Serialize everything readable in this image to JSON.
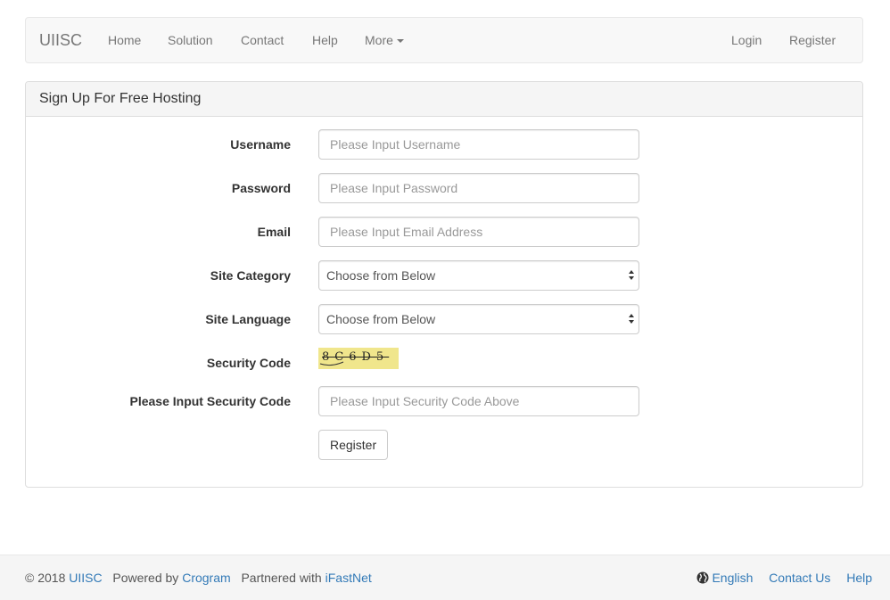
{
  "navbar": {
    "brand": "UIISC",
    "left_items": [
      "Home",
      "Solution",
      "Contact",
      "Help",
      "More"
    ],
    "right_items": [
      "Login",
      "Register"
    ]
  },
  "panel": {
    "title": "Sign Up For Free Hosting"
  },
  "form": {
    "username_label": "Username",
    "username_placeholder": "Please Input Username",
    "password_label": "Password",
    "password_placeholder": "Please Input Password",
    "email_label": "Email",
    "email_placeholder": "Please Input Email Address",
    "site_category_label": "Site Category",
    "site_category_value": "Choose from Below",
    "site_language_label": "Site Language",
    "site_language_value": "Choose from Below",
    "security_code_label": "Security Code",
    "captcha_text": "8C6D5",
    "security_input_label": "Please Input Security Code",
    "security_input_placeholder": "Please Input Security Code Above",
    "submit_label": "Register"
  },
  "footer": {
    "copyright": "© 2018",
    "brand_link": "UIISC",
    "powered_by": "Powered by",
    "powered_link": "Crogram",
    "partnered_with": "Partnered with",
    "partner_link": "iFastNet",
    "language_link": "English",
    "contact_link": "Contact Us",
    "help_link": "Help"
  },
  "colors": {
    "link": "#337ab7",
    "navbar_bg": "#f8f8f8",
    "captcha_bg": "#f0e68c"
  }
}
